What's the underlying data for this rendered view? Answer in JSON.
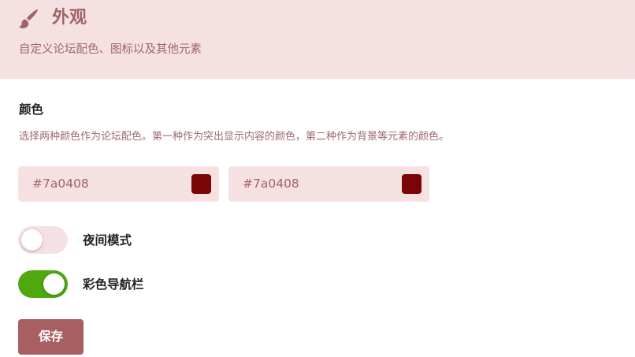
{
  "header": {
    "icon": "paintbrush-icon",
    "title": "外观",
    "description": "自定义论坛配色、图标以及其他元素"
  },
  "colors": {
    "title": "颜色",
    "description": "选择两种颜色作为论坛配色。第一种作为突出显示内容的颜色，第二种作为背景等元素的颜色。",
    "primary": "#7a0408",
    "secondary": "#7a0408"
  },
  "toggles": {
    "dark_mode": {
      "label": "夜间模式",
      "on": false
    },
    "colored_header": {
      "label": "彩色导航栏",
      "on": true
    }
  },
  "save_label": "保存",
  "theme": {
    "header_bg": "#f6e1e2",
    "accent_text": "#a06568",
    "toggle_on": "#4fa80d",
    "button_bg": "#a85f62"
  }
}
